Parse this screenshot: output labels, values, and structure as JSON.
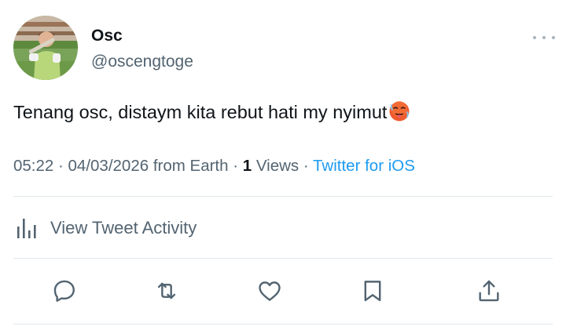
{
  "user": {
    "display_name": "Osc",
    "handle": "@oscengtoge"
  },
  "tweet": {
    "text": "Tenang osc, distaym kita rebut hati my nyimut",
    "emoji": "hot-face-emoji"
  },
  "meta": {
    "time": "05:22",
    "separator1": " · ",
    "date": "04/03/2026",
    "location": " from Earth",
    "separator2": " · ",
    "views_count": "1",
    "views_label": " Views",
    "separator3": " · ",
    "source": "Twitter for iOS"
  },
  "activity": {
    "label": "View Tweet Activity"
  },
  "colors": {
    "link": "#1d9bf0",
    "secondary_text": "#536471",
    "primary_text": "#0f1419",
    "divider": "#e1e6ea"
  },
  "icons": {
    "more": "more-horizontal-icon",
    "activity": "bar-chart-icon",
    "reply": "reply-icon",
    "retweet": "retweet-icon",
    "like": "heart-icon",
    "bookmark": "bookmark-icon",
    "share": "share-icon"
  }
}
